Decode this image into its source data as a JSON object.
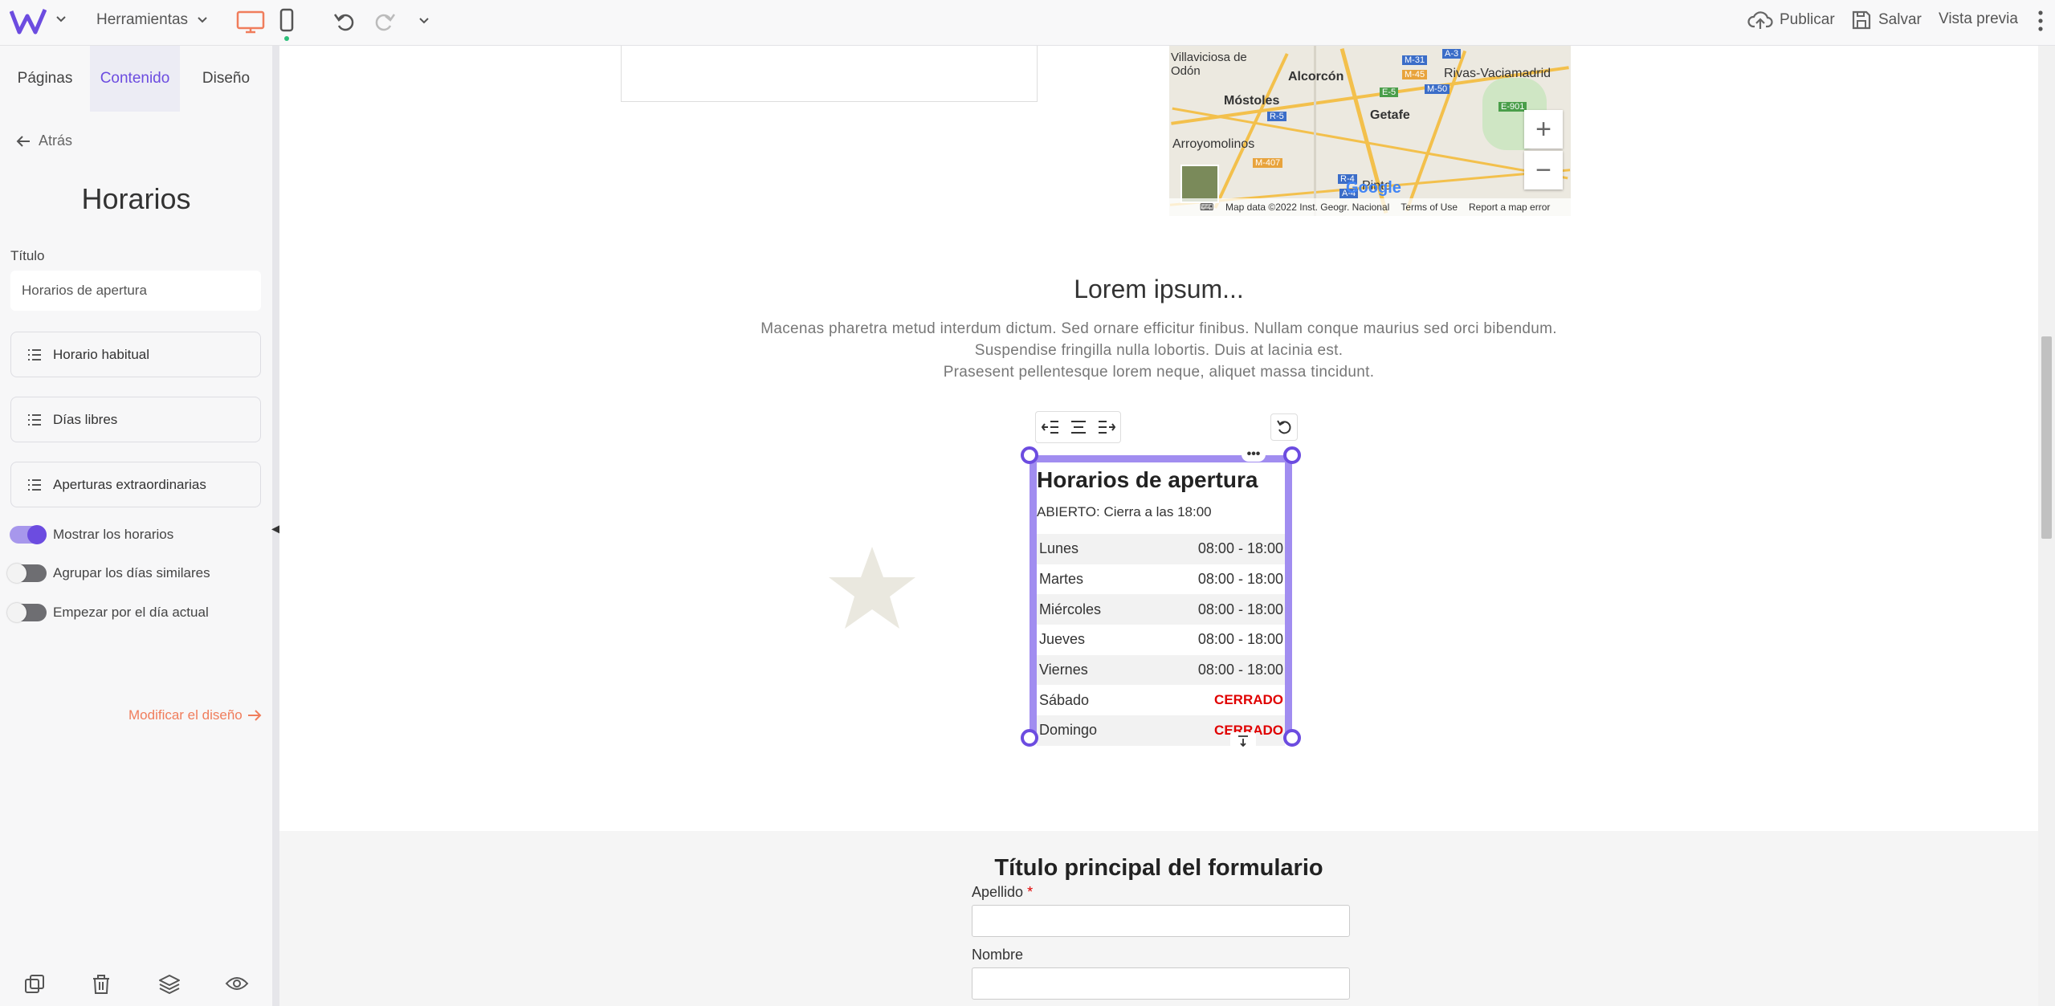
{
  "topbar": {
    "tools_label": "Herramientas",
    "publish_label": "Publicar",
    "save_label": "Salvar",
    "preview_label": "Vista previa"
  },
  "panel": {
    "tabs": [
      {
        "label": "Páginas"
      },
      {
        "label": "Contenido"
      },
      {
        "label": "Diseño"
      }
    ],
    "back_label": "Atrás",
    "title": "Horarios",
    "title_field_label": "Título",
    "title_field_value": "Horarios de apertura",
    "items": [
      {
        "label": "Horario habitual"
      },
      {
        "label": "Días libres"
      },
      {
        "label": "Aperturas extraordinarias"
      }
    ],
    "toggles": [
      {
        "label": "Mostrar los horarios",
        "on": true
      },
      {
        "label": "Agrupar los días similares",
        "on": false
      },
      {
        "label": "Empezar por el día actual",
        "on": false
      }
    ],
    "modify_link": "Modificar el diseño"
  },
  "map": {
    "labels": [
      "Villaviciosa de Odón",
      "Alcorcón",
      "Móstoles",
      "Getafe",
      "Rivas-Vaciamadrid",
      "Arroyomolinos",
      "Pinto"
    ],
    "road_labels": [
      "M-31",
      "A-3",
      "M-45",
      "M-50",
      "E-5",
      "R-5",
      "E-901",
      "M-407",
      "R-4",
      "A-4"
    ],
    "footer": {
      "data": "Map data ©2022 Inst. Geogr. Nacional",
      "terms": "Terms of Use",
      "report": "Report a map error",
      "google": "Google"
    }
  },
  "lorem": {
    "title": "Lorem ipsum...",
    "lines": [
      "Macenas pharetra metud interdum dictum. Sed ornare efficitur finibus. Nullam conque maurius sed orci bibendum.",
      "Suspendise fringilla nulla lobortis. Duis at lacinia est.",
      "Prasesent pellentesque lorem neque, aliquet massa tincidunt."
    ]
  },
  "hours_widget": {
    "title": "Horarios de apertura",
    "status": "ABIERTO: Cierra a las 18:00",
    "rows": [
      {
        "day": "Lunes",
        "hours": "08:00 - 18:00",
        "closed": false
      },
      {
        "day": "Martes",
        "hours": "08:00 - 18:00",
        "closed": false
      },
      {
        "day": "Miércoles",
        "hours": "08:00 - 18:00",
        "closed": false
      },
      {
        "day": "Jueves",
        "hours": "08:00 - 18:00",
        "closed": false
      },
      {
        "day": "Viernes",
        "hours": "08:00 - 18:00",
        "closed": false
      },
      {
        "day": "Sábado",
        "hours": "CERRADO",
        "closed": true
      },
      {
        "day": "Domingo",
        "hours": "CERRADO",
        "closed": true
      }
    ]
  },
  "form": {
    "title": "Título principal del formulario",
    "fields": [
      {
        "label": "Apellido",
        "required_mark": "*"
      },
      {
        "label": "Nombre",
        "required_mark": ""
      }
    ]
  },
  "colors": {
    "accent": "#6c4ce0",
    "selection": "#a18df0",
    "link": "#f07d5c",
    "closed": "#e00000",
    "device_active": "#f07d5c"
  }
}
